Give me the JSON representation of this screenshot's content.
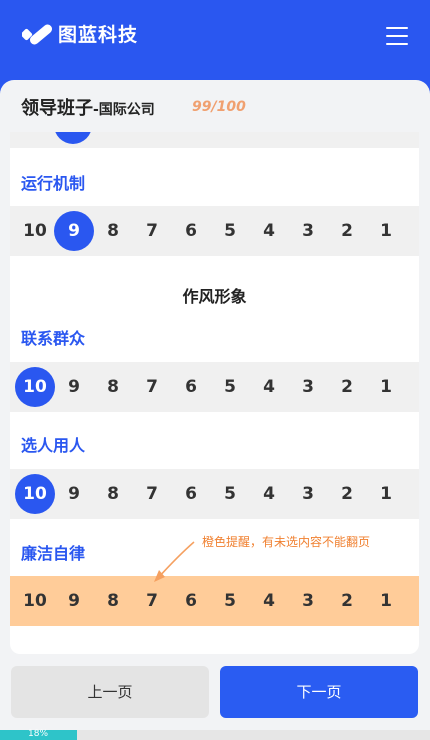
{
  "header": {
    "brand": "图蓝科技",
    "logo_icon": "check-logo-icon",
    "menu_icon": "hamburger-icon"
  },
  "survey": {
    "title": "领导班子",
    "subtitle": "-国际公司",
    "score": "99/100"
  },
  "options": [
    "10",
    "9",
    "8",
    "7",
    "6",
    "5",
    "4",
    "3",
    "2",
    "1"
  ],
  "questions": [
    {
      "label": "运行机制",
      "selected": "9"
    },
    {
      "label": "联系群众",
      "selected": "10"
    },
    {
      "label": "选人用人",
      "selected": "10"
    },
    {
      "label": "廉洁自律",
      "selected": null,
      "warning": true
    }
  ],
  "section": {
    "title": "作风形象"
  },
  "annotation": {
    "text": "橙色提醒，有未选内容不能翻页"
  },
  "buttons": {
    "prev": "上一页",
    "next": "下一页"
  },
  "progress": {
    "label": "18%",
    "fraction": 0.18
  },
  "colors": {
    "primary": "#2a57f0",
    "warning": "#ffcc99",
    "progress": "#2ec4c9"
  }
}
